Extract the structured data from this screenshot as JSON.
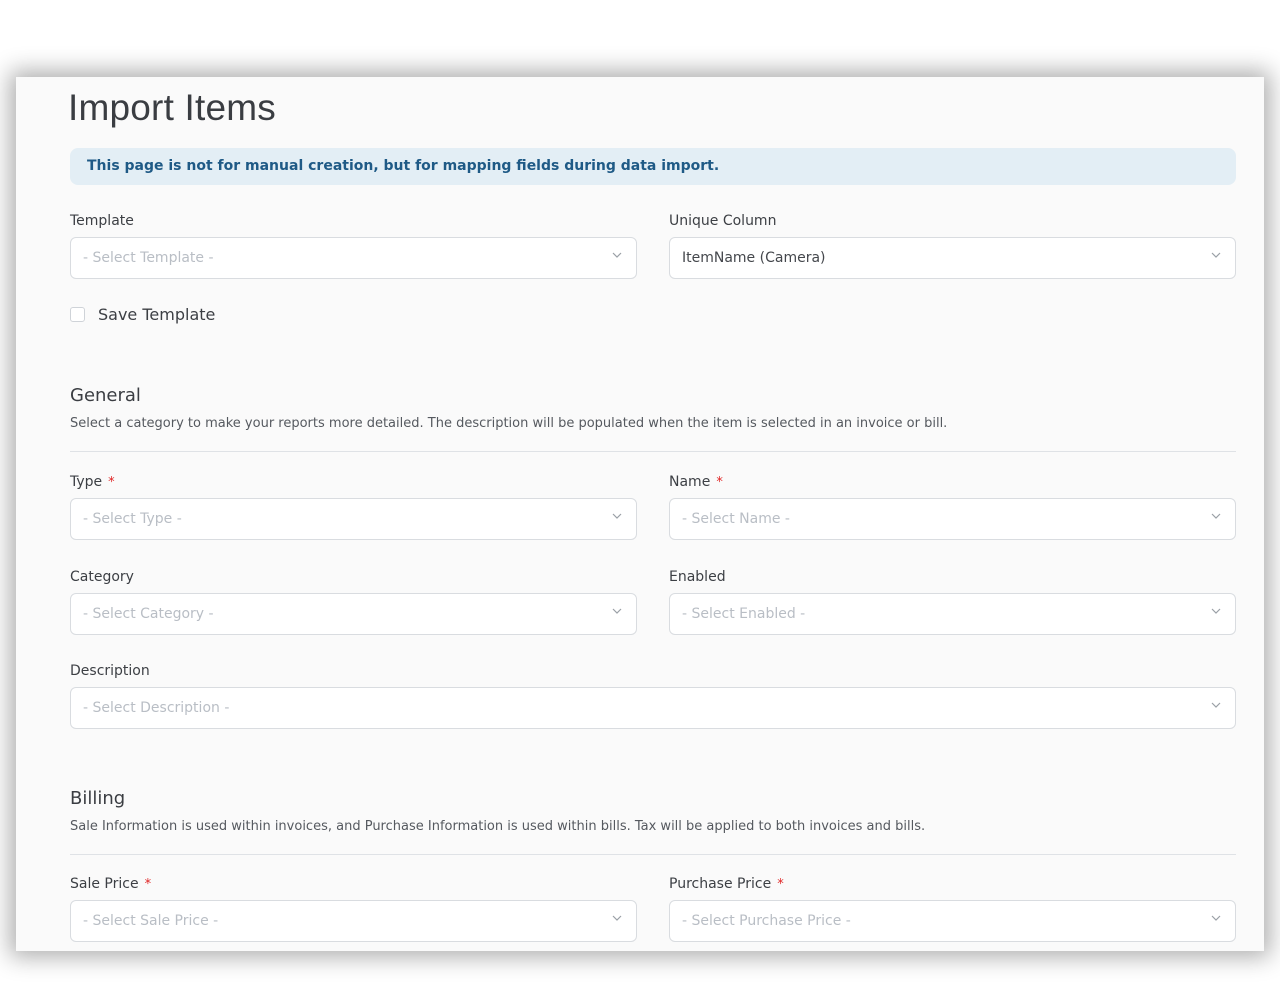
{
  "page": {
    "title": "Import Items"
  },
  "alert": {
    "text": "This page is not for manual creation, but for mapping fields during data import."
  },
  "top_fields": {
    "template": {
      "label": "Template",
      "placeholder": "- Select Template -"
    },
    "unique_column": {
      "label": "Unique Column",
      "value": "ItemName (Camera)"
    },
    "save_template": {
      "label": "Save Template",
      "checked": false
    }
  },
  "general": {
    "title": "General",
    "description": "Select a category to make your reports more detailed. The description will be populated when the item is selected in an invoice or bill.",
    "fields": {
      "type": {
        "label": "Type",
        "required": "*",
        "placeholder": "- Select Type -"
      },
      "name": {
        "label": "Name",
        "required": "*",
        "placeholder": "- Select Name -"
      },
      "category": {
        "label": "Category",
        "placeholder": "- Select Category -"
      },
      "enabled": {
        "label": "Enabled",
        "placeholder": "- Select Enabled -"
      },
      "description": {
        "label": "Description",
        "placeholder": "- Select Description -"
      }
    }
  },
  "billing": {
    "title": "Billing",
    "description": "Sale Information is used within invoices, and Purchase Information is used within bills. Tax will be applied to both invoices and bills.",
    "fields": {
      "sale_price": {
        "label": "Sale Price",
        "required": "*",
        "placeholder": "- Select Sale Price -"
      },
      "purchase_price": {
        "label": "Purchase Price",
        "required": "*",
        "placeholder": "- Select Purchase Price -"
      }
    }
  },
  "icons": {
    "dropdown": "chevron-down-icon"
  },
  "colors": {
    "alert_bg": "#e3eef5",
    "alert_text": "#1f5a86",
    "required": "#e02424"
  }
}
